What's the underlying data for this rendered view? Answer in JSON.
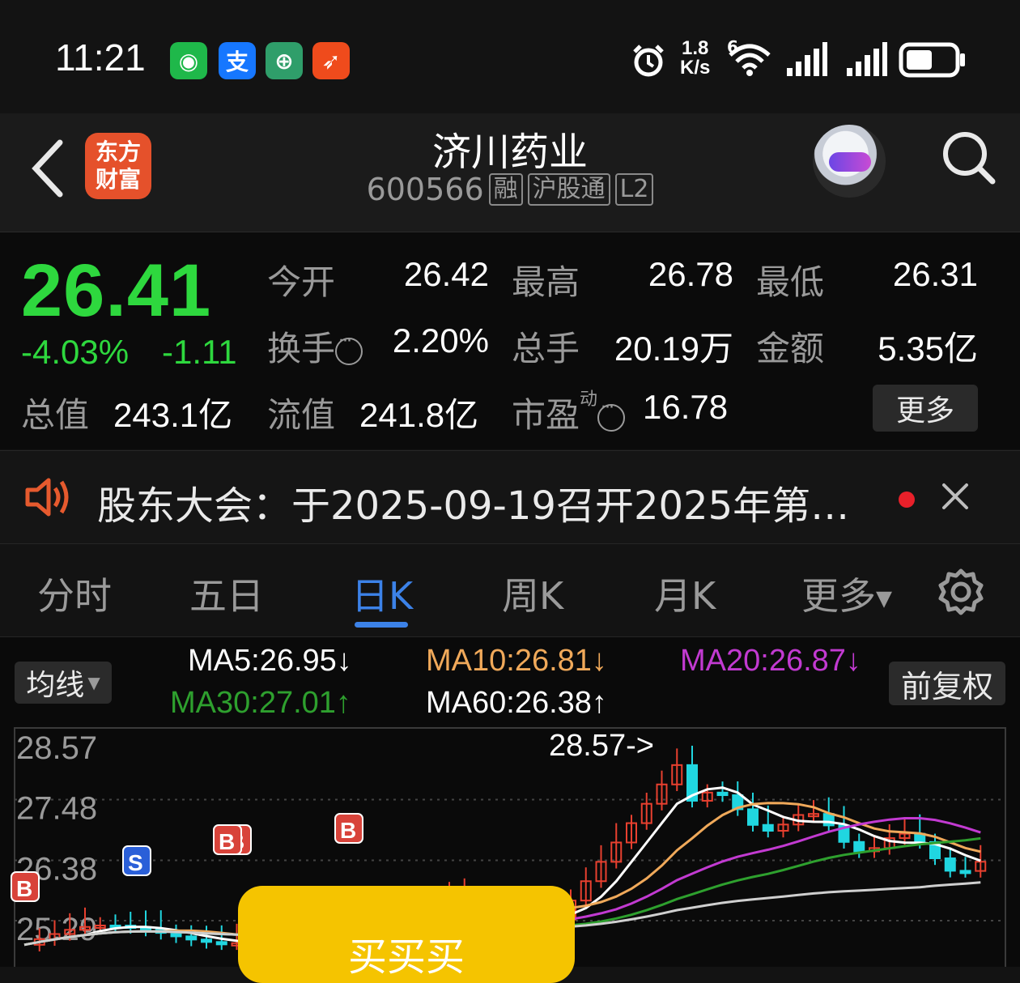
{
  "status_bar": {
    "time": "11:21",
    "app_icons": [
      {
        "name": "wechat-icon",
        "glyph": "◉",
        "color": "#1fb84a"
      },
      {
        "name": "alipay-icon",
        "glyph": "支",
        "color": "#1677ff"
      },
      {
        "name": "bank-icon",
        "glyph": "⊕",
        "color": "#2f9e6a"
      },
      {
        "name": "app-icon-orange",
        "glyph": "➶",
        "color": "#ef4b1c"
      }
    ],
    "net_speed_top": "1.8",
    "net_speed_unit": "K/s",
    "wifi_gen": "6",
    "battery_level_fraction": 0.55
  },
  "header": {
    "logo_line1": "东方",
    "logo_line2": "财富",
    "stock_name": "济川药业",
    "stock_code": "600566",
    "tags": [
      "融",
      "沪股通",
      "L2"
    ]
  },
  "quote": {
    "price": "26.41",
    "change_pct": "-4.03%",
    "change_amt": "-1.11",
    "open_label": "今开",
    "open_value": "26.42",
    "high_label": "最高",
    "high_value": "26.78",
    "low_label": "最低",
    "low_value": "26.31",
    "turnover_label": "换手",
    "turnover_value": "2.20%",
    "volume_label": "总手",
    "volume_value": "20.19万",
    "amount_label": "金额",
    "amount_value": "5.35亿",
    "mktcap_label": "总值",
    "mktcap_value": "243.1亿",
    "float_label": "流值",
    "float_value": "241.8亿",
    "pe_label": "市盈",
    "pe_sup": "动",
    "pe_value": "16.78",
    "more_label": "更多"
  },
  "notice": {
    "text": "股东大会：于2025-09-19召开2025年第…"
  },
  "tabs": {
    "items": [
      "分时",
      "五日",
      "日K",
      "周K",
      "月K",
      "更多"
    ],
    "active": "日K"
  },
  "chart": {
    "ma_button": "均线",
    "adjust_button": "前复权",
    "ma5": "MA5:26.95↓",
    "ma10": "MA10:26.81↓",
    "ma20": "MA20:26.87↓",
    "ma30": "MA30:27.01↑",
    "ma60": "MA60:26.38↑",
    "colors": {
      "ma5": "#ffffff",
      "ma10": "#f0a95a",
      "ma20": "#c23ad1",
      "ma30": "#2ea02e",
      "ma60": "#ffffff"
    },
    "y_ticks": [
      "28.57",
      "27.48",
      "26.38",
      "25.29"
    ],
    "high_marker": "28.57->",
    "signals": [
      "B",
      "S",
      "B",
      "B",
      "B"
    ],
    "buy_button": "买买买"
  },
  "chart_data": {
    "type": "candlestick",
    "y_ticks": [
      28.57,
      27.48,
      26.38,
      25.29
    ],
    "annotations": [
      "28.57->"
    ],
    "series": [
      {
        "name": "MA5",
        "value": 26.95
      },
      {
        "name": "MA10",
        "value": 26.81
      },
      {
        "name": "MA20",
        "value": 26.87
      },
      {
        "name": "MA30",
        "value": 27.01
      },
      {
        "name": "MA60",
        "value": 26.38
      }
    ]
  }
}
